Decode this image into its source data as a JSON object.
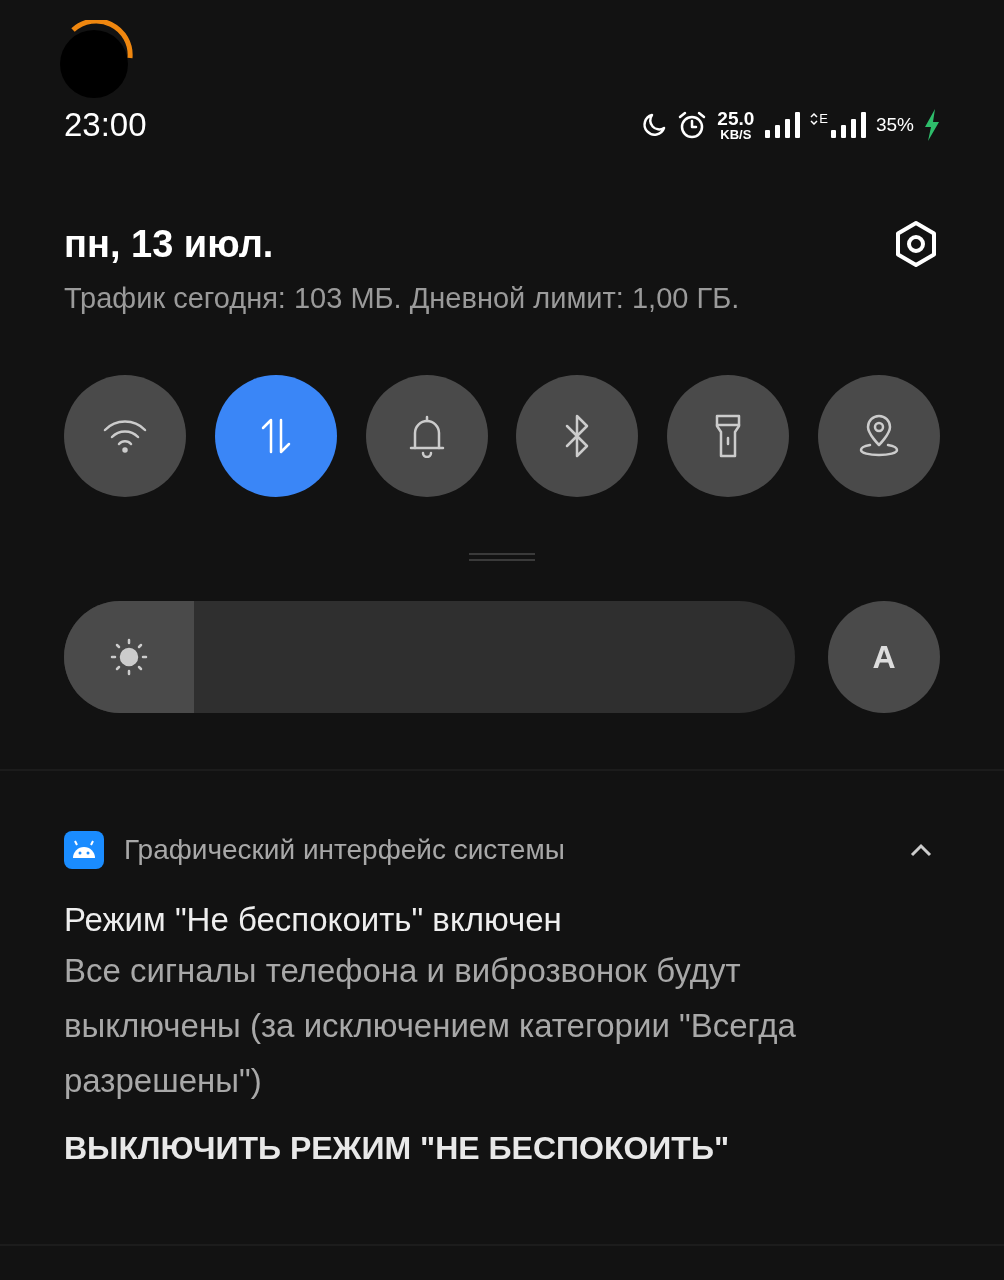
{
  "status_bar": {
    "time": "23:00",
    "speed_value": "25.0",
    "speed_unit": "KB/S",
    "network_type": "E",
    "battery": "35%",
    "charging": true
  },
  "header": {
    "date": "пн, 13 июл.",
    "traffic": "Трафик сегодня: 103 МБ. Дневной лимит: 1,00 ГБ."
  },
  "toggles": [
    {
      "kind": "wifi",
      "on": false
    },
    {
      "kind": "data",
      "on": true
    },
    {
      "kind": "sound",
      "on": false
    },
    {
      "kind": "bluetooth",
      "on": false
    },
    {
      "kind": "flashlight",
      "on": false
    },
    {
      "kind": "location",
      "on": false
    }
  ],
  "brightness": {
    "level": 0.178,
    "auto_label": "A"
  },
  "notification": {
    "app": "Графический интерфейс системы",
    "expanded": true,
    "title": "Режим \"Не беспокоить\" включен",
    "text": "Все сигналы телефона и виброзвонок будут выключены (за исключением категории \"Всегда разрешены\")",
    "action": "ВЫКЛЮЧИТЬ РЕЖИМ \"НЕ БЕСПОКОИТЬ\""
  }
}
